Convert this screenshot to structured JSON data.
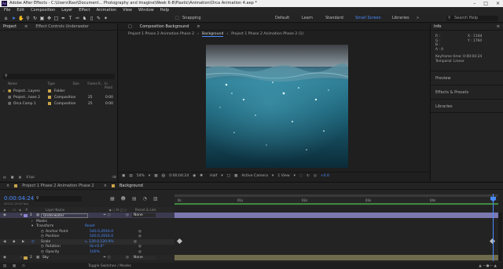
{
  "window": {
    "title": "Adobe After Effects - C:\\Users\\Rasi\\Document... Photography and Imagine\\Week 6-8\\Plastic\\Animation\\Orca Animation 4.aep *",
    "app_icon": "Ae"
  },
  "menu": [
    "File",
    "Edit",
    "Composition",
    "Layer",
    "Effect",
    "Animation",
    "View",
    "Window",
    "Help"
  ],
  "toolbar": {
    "snapping_label": "Snapping",
    "workspaces": [
      "Default",
      "Learn",
      "Standard",
      "Small Screen",
      "Libraries"
    ],
    "active_workspace": "Small Screen",
    "search_placeholder": "Search Help"
  },
  "project_panel": {
    "tabs": [
      "Project",
      "Effect Controls Underwater"
    ],
    "search_placeholder": "",
    "columns": [
      "Name",
      "Type",
      "Size",
      "Frame R...",
      "In Point"
    ],
    "items": [
      {
        "name": "Project...Layers",
        "type": "Folder",
        "size": "",
        "frame_rate": "",
        "in_point": ""
      },
      {
        "name": "Project...hase 2",
        "type": "Composition",
        "size": "",
        "frame_rate": "25",
        "in_point": "0:00"
      },
      {
        "name": "Orca Comp 1",
        "type": "Composition",
        "size": "",
        "frame_rate": "25",
        "in_point": "0:00"
      }
    ],
    "footer_bpc": "8 bpc"
  },
  "composition_panel": {
    "tab_label": "Composition Background",
    "breadcrumbs": [
      "Project 1 Phase 2 Animation Phase 2",
      "Background",
      "Project 1 Phase 2 Animation Phase 2 (1)"
    ],
    "active_breadcrumb": "Background",
    "zoom": "54%",
    "time": "0:00:04:24",
    "resolution": "Half",
    "camera": "Active Camera",
    "views": "1 View",
    "exposure": "+0.0"
  },
  "info_panel": {
    "title": "Info",
    "r": "R :",
    "g": "G :",
    "b": "B :",
    "a": "A :  0",
    "x": "X : 1184",
    "y": "Y : 1760",
    "keyframe_time": "Keyframe time: 0:00:04:24",
    "temporal": "Temporal: Linear",
    "sections": [
      "Preview",
      "Effects & Presets",
      "Libraries"
    ]
  },
  "timeline": {
    "tabs": [
      "Project 1 Phase 2 Animation Phase 2",
      "Background"
    ],
    "active_tab": "Background",
    "current_time": "0:00:04:24",
    "frame_info": "00124 (25.00 fps)",
    "columns": {
      "layer_name": "Layer Name",
      "parent": "Parent & Link"
    },
    "ruler_ticks": [
      "0s",
      "01s",
      "02s",
      "03s",
      "04s"
    ],
    "layers": [
      {
        "num": "1",
        "name": "Underwater",
        "parent": "None",
        "selected": true
      },
      {
        "num": "2",
        "name": "Sky",
        "parent": "None",
        "selected": false
      }
    ],
    "masks_label": "Masks",
    "transform_label": "Transform",
    "reset_label": "Reset",
    "properties": [
      {
        "name": "Anchor Point",
        "value": "540.0,2916.0"
      },
      {
        "name": "Position",
        "value": "540.0,2916.0"
      },
      {
        "name": "Scale",
        "value": "⊾ 120.0,120.0%"
      },
      {
        "name": "Rotation",
        "value": "0x+0.0°"
      },
      {
        "name": "Opacity",
        "value": "100%"
      }
    ],
    "footer": "Toggle Switches / Modes"
  },
  "colors": {
    "accent_blue": "#4a8cff",
    "timeline_green": "#3f8a3f",
    "layer_bar": "#7b78b0",
    "sky_bar": "#6e6a4c"
  }
}
